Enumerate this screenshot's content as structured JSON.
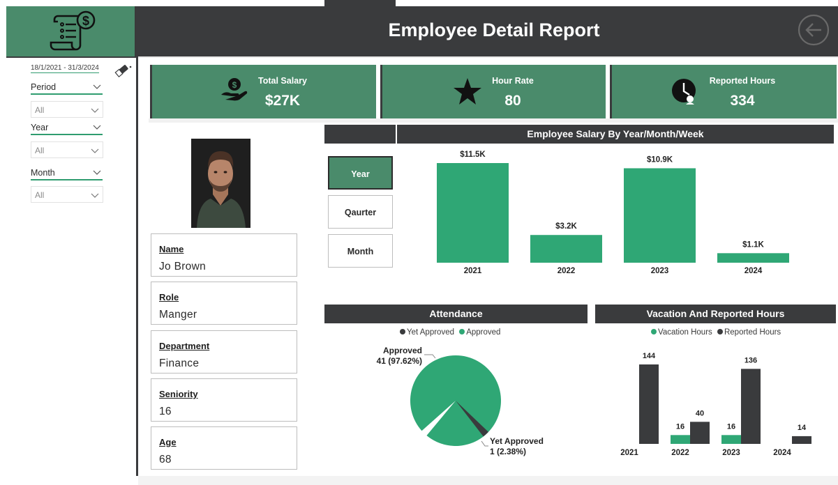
{
  "header": {
    "title": "Employee Detail Report"
  },
  "colors": {
    "accent": "#4a8b6b",
    "bar_green": "#2fa775",
    "dark": "#3a3b3d"
  },
  "sidebar": {
    "date_range": "18/1/2021 - 31/3/2024",
    "slicers": [
      {
        "label": "Period",
        "value": "All"
      },
      {
        "label": "Year",
        "value": "All"
      },
      {
        "label": "Month",
        "value": "All"
      }
    ]
  },
  "kpis": [
    {
      "title": "Total Salary",
      "value": "$27K",
      "icon": "money-hand-icon"
    },
    {
      "title": "Hour Rate",
      "value": "80",
      "icon": "star-icon"
    },
    {
      "title": "Reported Hours",
      "value": "334",
      "icon": "clock-icon"
    }
  ],
  "employee": {
    "fields": [
      {
        "label": "Name",
        "value": "Jo Brown"
      },
      {
        "label": "Role",
        "value": "Manger"
      },
      {
        "label": "Department",
        "value": "Finance"
      },
      {
        "label": "Seniority",
        "value": "16"
      },
      {
        "label": "Age",
        "value": "68"
      }
    ]
  },
  "period_buttons": [
    {
      "label": "Year",
      "active": true
    },
    {
      "label": "Qaurter",
      "active": false
    },
    {
      "label": "Month",
      "active": false
    }
  ],
  "chart_data": [
    {
      "type": "bar",
      "title": "Employee Salary By Year/Month/Week",
      "categories": [
        "2021",
        "2022",
        "2023",
        "2024"
      ],
      "values": [
        11500,
        3200,
        10900,
        1100
      ],
      "data_labels": [
        "$11.5K",
        "$3.2K",
        "$10.9K",
        "$1.1K"
      ],
      "color": "#2fa775"
    },
    {
      "type": "pie",
      "title": "Attendance",
      "legend": [
        "Yet Approved",
        "Approved"
      ],
      "slices": [
        {
          "name": "Approved",
          "value": 41,
          "label": "41 (97.62%)",
          "color": "#2fa775"
        },
        {
          "name": "Yet Approved",
          "value": 1,
          "label": "1 (2.38%)",
          "color": "#3a3b3d"
        }
      ]
    },
    {
      "type": "bar",
      "title": "Vacation And Reported Hours",
      "categories": [
        "2021",
        "2022",
        "2023",
        "2024"
      ],
      "series": [
        {
          "name": "Vacation Hours",
          "values": [
            null,
            16,
            16,
            null
          ],
          "color": "#2fa775"
        },
        {
          "name": "Reported Hours",
          "values": [
            144,
            40,
            136,
            14
          ],
          "color": "#3a3b3d"
        }
      ],
      "legend_position": "top"
    }
  ]
}
